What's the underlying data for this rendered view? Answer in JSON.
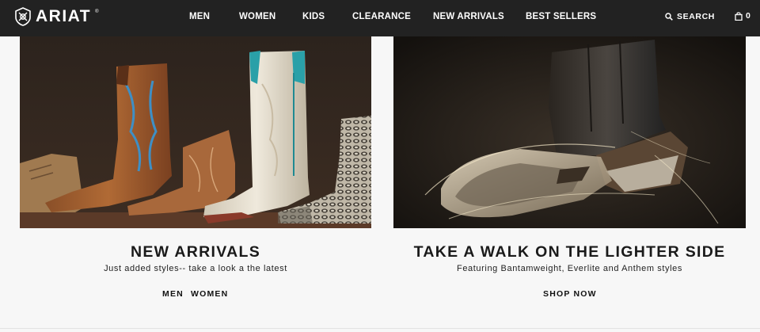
{
  "header": {
    "logo_text": "ARIAT",
    "logo_tm": "®",
    "nav": [
      "MEN",
      "WOMEN",
      "KIDS",
      "CLEARANCE",
      "NEW ARRIVALS",
      "BEST SELLERS"
    ],
    "search_label": "SEARCH",
    "cart_count": "0"
  },
  "promos": [
    {
      "title": "NEW ARRIVALS",
      "subtitle": "Just added styles-- take a look a the latest",
      "links": [
        "MEN",
        "WOMEN"
      ]
    },
    {
      "title": "TAKE A WALK ON THE LIGHTER SIDE",
      "subtitle": "Featuring Bantamweight, Everlite and Anthem styles",
      "links": [
        "SHOP NOW"
      ]
    }
  ],
  "colors": {
    "header_bg": "#222222",
    "page_bg": "#f7f7f7",
    "text": "#1a1a1a"
  }
}
